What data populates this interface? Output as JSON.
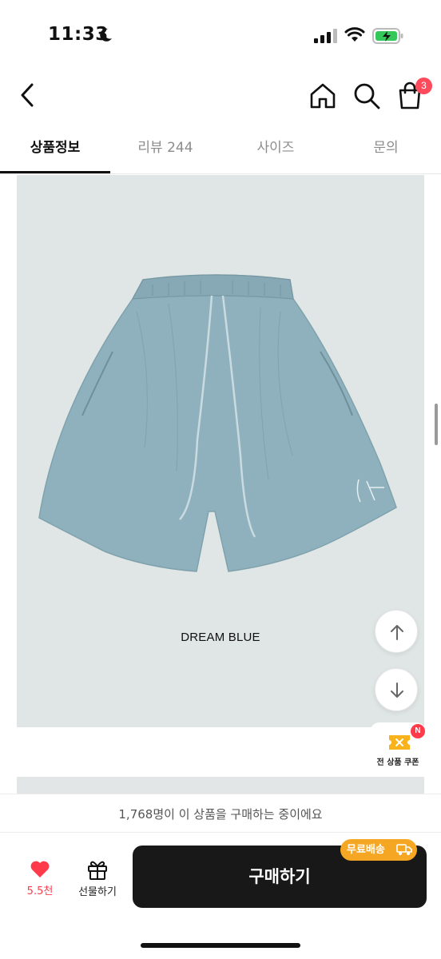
{
  "status_bar": {
    "time": "11:33"
  },
  "nav": {
    "cart_count": "3"
  },
  "tabs": [
    {
      "label": "상품정보",
      "active": true
    },
    {
      "label": "리뷰 244",
      "active": false
    },
    {
      "label": "사이즈",
      "active": false
    },
    {
      "label": "문의",
      "active": false
    }
  ],
  "product": {
    "caption": "DREAM BLUE",
    "image_color": "#dfe6e5",
    "shorts_color": "#8fb1bd"
  },
  "coupon": {
    "badge": "N",
    "label": "전 상품 쿠폰"
  },
  "bottom": {
    "buyers_text": "1,768명이 이 상품을 구매하는 중이에요",
    "like_count": "5.5천",
    "gift_label": "선물하기",
    "buy_label": "구매하기",
    "free_shipping": "무료배송"
  },
  "colors": {
    "accent_red": "#ff3a4a",
    "shipping_orange": "#f5a623",
    "buy_button": "#181818"
  }
}
